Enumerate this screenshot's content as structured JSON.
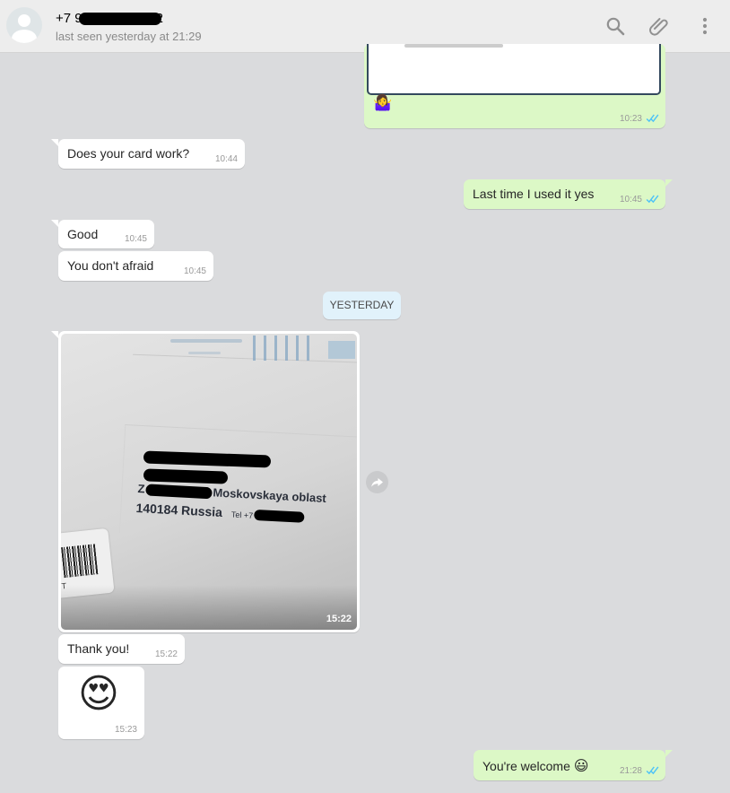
{
  "header": {
    "name_prefix": "+7 9",
    "name_suffix": "2",
    "status": "last seen yesterday at 21:29",
    "icons": [
      "search-icon",
      "attach-icon",
      "menu-icon"
    ]
  },
  "messages": {
    "m0": {
      "emoji": "🤷‍♀️",
      "time": "10:23"
    },
    "m1": {
      "text": "Does your card work?",
      "time": "10:44"
    },
    "m2": {
      "text": "Last time I used it yes",
      "time": "10:45"
    },
    "m3": {
      "text": "Good",
      "time": "10:45"
    },
    "m4": {
      "text": "You don't afraid",
      "time": "10:45"
    },
    "day_divider": "YESTERDAY",
    "photo": {
      "time": "15:22",
      "address_line1": "Moskovskaya oblast",
      "address_line2": "140184 Russia",
      "tel": "Tel +7",
      "letter_z": "Z"
    },
    "m6": {
      "text": "Thank you!",
      "time": "15:22"
    },
    "m7": {
      "emoji": "😍",
      "time": "15:23"
    },
    "m8": {
      "text": "You're welcome",
      "emoji": "😃",
      "time": "21:28"
    }
  },
  "colors": {
    "header_bg": "#ededed",
    "chat_bg": "#dadbdd",
    "incoming_bubble": "#ffffff",
    "outgoing_bubble": "#dcf8c6",
    "read_ticks": "#4fc3f7",
    "day_divider_bg": "#e1f2fb"
  }
}
